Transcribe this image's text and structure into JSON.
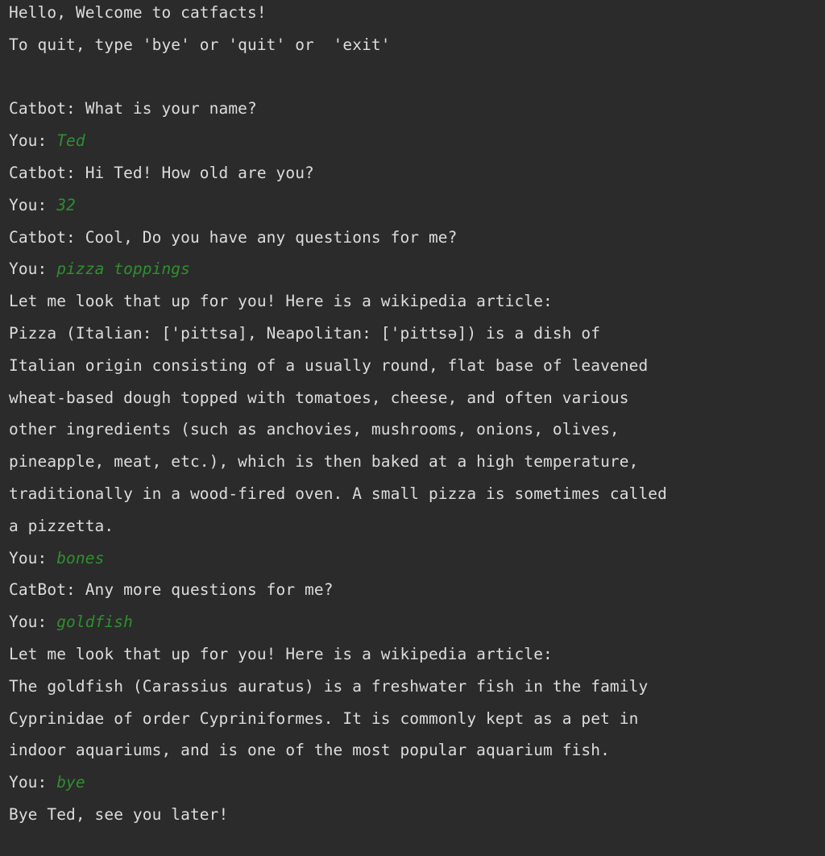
{
  "colors": {
    "background": "#2b2b2b",
    "output_text": "#dcdcdc",
    "user_input": "#2f8f2f"
  },
  "console": {
    "lines": [
      {
        "type": "output",
        "text": "Hello, Welcome to catfacts!"
      },
      {
        "type": "output",
        "text": "To quit, type 'bye' or 'quit' or  'exit'"
      },
      {
        "type": "blank",
        "text": ""
      },
      {
        "type": "output",
        "text": "Catbot: What is your name?"
      },
      {
        "type": "input",
        "prompt": "You: ",
        "text": "Ted"
      },
      {
        "type": "output",
        "text": "Catbot: Hi Ted! How old are you?"
      },
      {
        "type": "input",
        "prompt": "You: ",
        "text": "32"
      },
      {
        "type": "output",
        "text": "Catbot: Cool, Do you have any questions for me?"
      },
      {
        "type": "input",
        "prompt": "You: ",
        "text": "pizza toppings"
      },
      {
        "type": "output",
        "text": "Let me look that up for you! Here is a wikipedia article:"
      },
      {
        "type": "output",
        "text": "Pizza (Italian: ['pittsa], Neapolitan: ['pittsə]) is a dish of"
      },
      {
        "type": "output",
        "text": "Italian origin consisting of a usually round, flat base of leavened"
      },
      {
        "type": "output",
        "text": "wheat-based dough topped with tomatoes, cheese, and often various"
      },
      {
        "type": "output",
        "text": "other ingredients (such as anchovies, mushrooms, onions, olives,"
      },
      {
        "type": "output",
        "text": "pineapple, meat, etc.), which is then baked at a high temperature,"
      },
      {
        "type": "output",
        "text": "traditionally in a wood-fired oven. A small pizza is sometimes called"
      },
      {
        "type": "output",
        "text": "a pizzetta."
      },
      {
        "type": "input",
        "prompt": "You: ",
        "text": "bones"
      },
      {
        "type": "output",
        "text": "CatBot: Any more questions for me?"
      },
      {
        "type": "input",
        "prompt": "You: ",
        "text": "goldfish"
      },
      {
        "type": "output",
        "text": "Let me look that up for you! Here is a wikipedia article:"
      },
      {
        "type": "output",
        "text": "The goldfish (Carassius auratus) is a freshwater fish in the family"
      },
      {
        "type": "output",
        "text": "Cyprinidae of order Cypriniformes. It is commonly kept as a pet in"
      },
      {
        "type": "output",
        "text": "indoor aquariums, and is one of the most popular aquarium fish."
      },
      {
        "type": "input",
        "prompt": "You: ",
        "text": "bye"
      },
      {
        "type": "output",
        "text": "Bye Ted, see you later!"
      }
    ]
  }
}
